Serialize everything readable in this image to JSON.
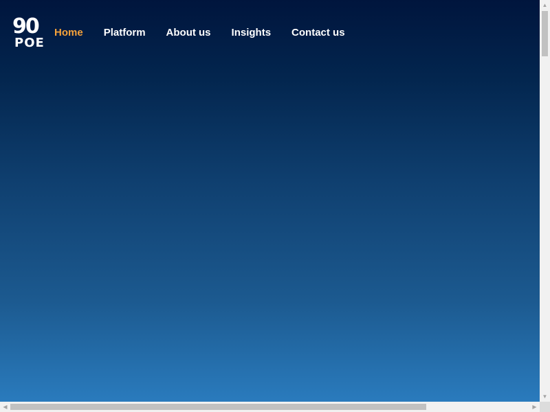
{
  "brand": {
    "logo_line1": "90",
    "logo_line2": "POE"
  },
  "nav": {
    "items": [
      {
        "label": "Home",
        "active": true
      },
      {
        "label": "Platform",
        "active": false
      },
      {
        "label": "About us",
        "active": false
      },
      {
        "label": "Insights",
        "active": false
      },
      {
        "label": "Contact us",
        "active": false
      }
    ]
  },
  "colors": {
    "active_nav": "#f5a23a",
    "nav_text": "#ffffff",
    "gradient_top": "#00153d",
    "gradient_bottom": "#2a7bbd"
  },
  "scrollbars": {
    "up_arrow_icon": "chevron-up-icon",
    "down_arrow_icon": "chevron-down-icon",
    "left_arrow_icon": "chevron-left-icon",
    "right_arrow_icon": "chevron-right-icon"
  }
}
